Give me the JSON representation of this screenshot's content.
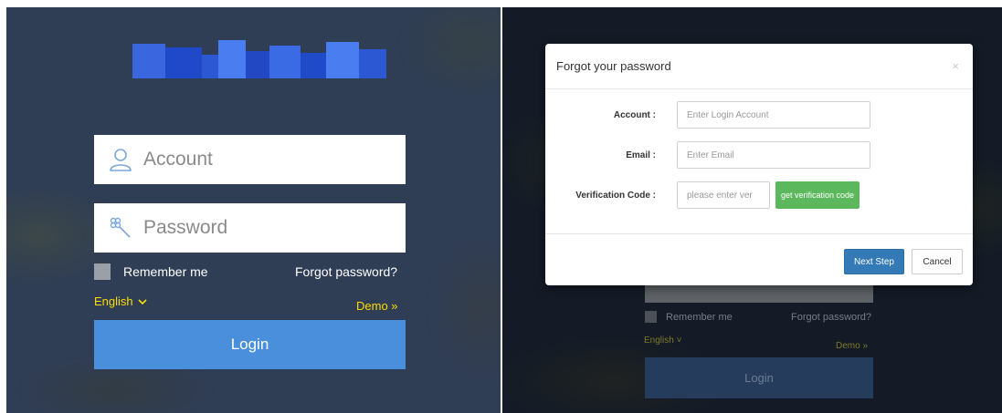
{
  "login_page": {
    "account_placeholder": "Account",
    "password_placeholder": "Password",
    "remember_label": "Remember me",
    "forgot_label": "Forgot password?",
    "language_label": "English",
    "language_chevron": "˅",
    "demo_label": "Demo »",
    "login_label": "Login",
    "logo_colors": [
      "#2a5bd7",
      "#1e48c8",
      "#3b6fe8",
      "#2f5fd0",
      "#4a7ef0"
    ],
    "field_bg": "#ffffff",
    "login_color": "#4a8fdb",
    "accent_yellow": "#ffdd00"
  },
  "background_page": {
    "remember_label": "Remember me",
    "forgot_label": "Forgot password?",
    "language_label": "English ˅",
    "demo_label": "Demo »",
    "login_label": "Login"
  },
  "modal": {
    "title": "Forgot your password",
    "close_glyph": "×",
    "account_label": "Account :",
    "account_placeholder": "Enter Login Account",
    "email_label": "Email :",
    "email_placeholder": "Enter Email",
    "code_label": "Verification Code :",
    "code_placeholder": "please enter ver",
    "get_code_label": "get verification code",
    "next_label": "Next Step",
    "cancel_label": "Cancel",
    "green_color": "#5cb85c",
    "primary_color": "#337ab7"
  }
}
